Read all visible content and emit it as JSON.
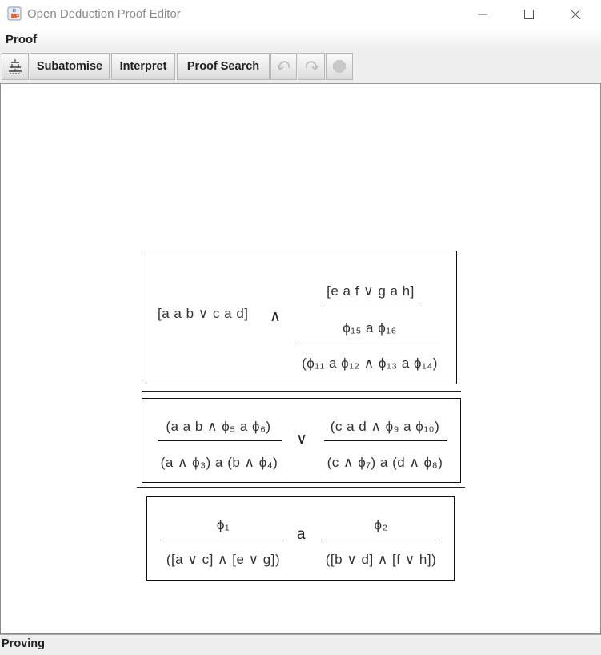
{
  "window": {
    "title": "Open Deduction Proof Editor",
    "icon": "java-cup-icon"
  },
  "menu": {
    "proof_label": "Proof"
  },
  "toolbar": {
    "tree_icon": "proof-tree-icon",
    "subatomise_label": "Subatomise",
    "interpret_label": "Interpret",
    "proof_search_label": "Proof Search",
    "undo_icon": "undo-icon",
    "redo_icon": "redo-icon",
    "stop_icon": "stop-icon"
  },
  "status": {
    "text": "Proving"
  },
  "proof": {
    "top": {
      "left": "[a a b ∨ c a d]",
      "op": "∧",
      "right_premise": "[e a f ∨ g a h]",
      "right_middle": "ϕ₁₅ a ϕ₁₆",
      "right_conclusion": "(ϕ₁₁ a ϕ₁₂ ∧ ϕ₁₃ a ϕ₁₄)"
    },
    "middle": {
      "left_premise": "(a a b ∧ ϕ₅ a ϕ₆)",
      "left_conclusion": "(a ∧ ϕ₃) a (b ∧ ϕ₄)",
      "op": "∨",
      "right_premise": "(c a d ∧ ϕ₉ a ϕ₁₀)",
      "right_conclusion": "(c ∧ ϕ₇) a (d ∧ ϕ₈)"
    },
    "bottom": {
      "left_premise": "ϕ₁",
      "left_conclusion": "([a ∨ c] ∧ [e ∨ g])",
      "op": "a",
      "right_premise": "ϕ₂",
      "right_conclusion": "([b ∨ d] ∧ [f ∨ h])"
    }
  }
}
